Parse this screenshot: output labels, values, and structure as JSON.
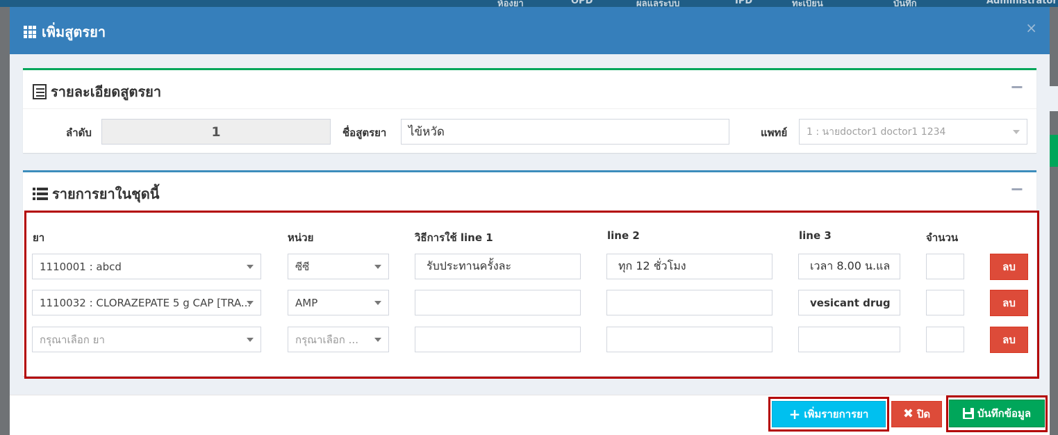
{
  "background": {
    "topbar_items": [
      "ห้องยา",
      "OPD",
      "ผลแลระบบ",
      "IPD",
      "ทะเบียน",
      "บันทึก",
      "Administrator"
    ]
  },
  "modal": {
    "title": "เพิ่มสูตรยา",
    "close_label": "×",
    "detail_box": {
      "title": "รายละเอียดสูตรยา",
      "collapse_label": "−",
      "order_label": "ลำดับ",
      "order_value": "1",
      "name_label": "ชื่อสูตรยา",
      "name_value": "ไข้หวัด",
      "doctor_label": "แพทย์",
      "doctor_value": "1 : นายdoctor1 doctor1 1234"
    },
    "items_box": {
      "title": "รายการยาในชุดนี้",
      "collapse_label": "−",
      "columns": {
        "drug": "ยา",
        "unit": "หน่วย",
        "usage1": "วิธีการใช้ line 1",
        "line2": "line 2",
        "line3": "line 3",
        "qty": "จำนวน"
      },
      "rows": [
        {
          "drug": "1110001 : abcd",
          "unit": "ซีซี",
          "line1": "รับประทานครั้งละ",
          "line2": "ทุก 12 ชั่วโมง",
          "line3": "เวลา  8.00 น.แล",
          "qty": "",
          "delete": "ลบ"
        },
        {
          "drug": "1110032 : CLORAZEPATE 5 g CAP [TRA...",
          "unit": "AMP",
          "line1": "",
          "line2": "",
          "line3": "vesicant drug",
          "qty": "",
          "delete": "ลบ"
        },
        {
          "drug": "",
          "unit": "",
          "line1": "",
          "line2": "",
          "line3": "",
          "qty": "",
          "delete": "ลบ"
        }
      ],
      "drug_placeholder": "กรุณาเลือก ยา",
      "unit_placeholder": "กรุณาเลือก ..."
    },
    "footer": {
      "add_label": "เพิ่มรายการยา",
      "close_label": "ปิด",
      "save_label": "บันทึกข้อมูล"
    }
  },
  "colors": {
    "header": "#367fbb",
    "add_button": "#00c0ef",
    "close_button": "#dd4b39",
    "save_button": "#00a65a",
    "highlight": "#b30000"
  }
}
